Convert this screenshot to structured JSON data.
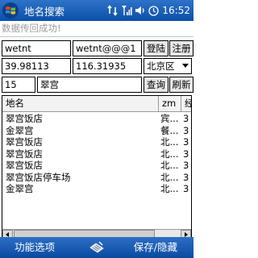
{
  "titlebar": {
    "title": "地名搜索",
    "clock": "16:52"
  },
  "status": {
    "text": "数据传回成功!"
  },
  "login": {
    "username": "wetnt",
    "password": "wetnt@@@1",
    "login_label": "登陆",
    "register_label": "注册"
  },
  "coords": {
    "latitude": "39.98113",
    "longitude": "116.31935",
    "district": "北京区"
  },
  "search": {
    "count": "15",
    "keyword": "翠宫",
    "query_label": "查询",
    "refresh_label": "刷新"
  },
  "list": {
    "headers": [
      "地名",
      "zm",
      "经"
    ],
    "rows": [
      [
        "翠宫饭店",
        "宾...",
        "3"
      ],
      [
        "金翠宫",
        "餐...",
        "3"
      ],
      [
        "翠宫饭店",
        "北...",
        "3"
      ],
      [
        "翠宫饭店",
        "北...",
        "3"
      ],
      [
        "翠宫饭店",
        "北...",
        "3"
      ],
      [
        "翠宫饭店停车场",
        "北...",
        "3"
      ],
      [
        "金翠宫",
        "北...",
        "3"
      ]
    ]
  },
  "menubar": {
    "left_label": "功能选项",
    "right_label": "保存/隐藏"
  },
  "icons": {
    "start": "windows-flag-icon",
    "connectivity": "sync-arrows-icon",
    "signal": "signal-strength-icon",
    "volume": "speaker-icon",
    "clock": "clock-icon",
    "keyboard": "keyboard-input-icon"
  }
}
